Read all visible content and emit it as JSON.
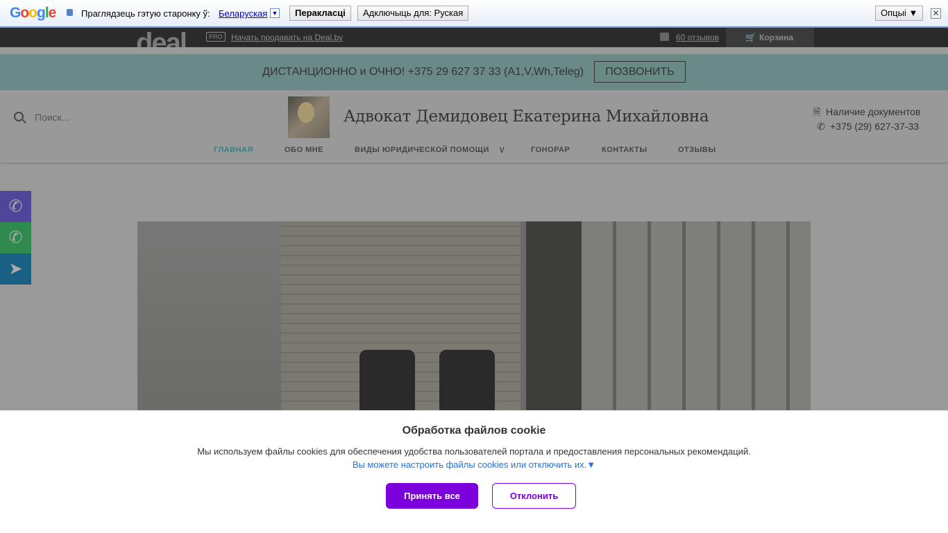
{
  "translate_bar": {
    "logo": "Google",
    "prompt": "Праглядзець гэтую старонку ў:",
    "language": "Беларуская",
    "translate_button": "Перакласці",
    "disable_button": "Адключыць для: Руская",
    "options_button": "Опцыі ▼",
    "close": "✕"
  },
  "deal_bar": {
    "logo": "deal",
    "pro_badge": "PRO",
    "sell_link": "Начать продавать на Deal.by",
    "reviews_link": "60 отзывов",
    "cart_label": "Корзина",
    "cart_icon": "🛒"
  },
  "banner": {
    "text": "ДИСТАНЦИОННО и ОЧНО! +375 29 627 37 33 (A1,V,Wh,Teleg)",
    "call_button": "ПОЗВОНИТЬ"
  },
  "header": {
    "search_placeholder": "Поиск...",
    "title": "Адвокат Демидовец Екатерина Михайловна",
    "docs_label": "Наличие документов",
    "phone": "+375 (29) 627-37-33",
    "docs_icon": "🗎",
    "phone_icon": "✆"
  },
  "nav": {
    "items": [
      {
        "label": "ГЛАВНАЯ"
      },
      {
        "label": "ОБО МНЕ"
      },
      {
        "label": "ВИДЫ ЮРИДИЧЕСКОЙ ПОМОЩИ"
      },
      {
        "label": "ГОНОРАР"
      },
      {
        "label": "КОНТАКТЫ"
      },
      {
        "label": "ОТЗЫВЫ"
      }
    ],
    "dropdown_icon": "∨"
  },
  "social": {
    "viber": {
      "icon": "✆",
      "color": "#4f4599"
    },
    "whatsapp": {
      "icon": "✆",
      "color": "#2e8a4f"
    },
    "telegram": {
      "icon": "➤",
      "color": "#1a6084"
    }
  },
  "cookie": {
    "title": "Обработка файлов cookie",
    "description": "Мы используем файлы cookies для обеспечения удобства пользователей портала и предоставления персональных рекомендаций.",
    "settings_link": "Вы можете настроить файлы cookies или отключить их.▼",
    "accept_button": "Принять все",
    "reject_button": "Отклонить"
  },
  "colors": {
    "accent": "#7b00db",
    "nav_active": "#3a7f86",
    "banner": "#6a8a88"
  }
}
